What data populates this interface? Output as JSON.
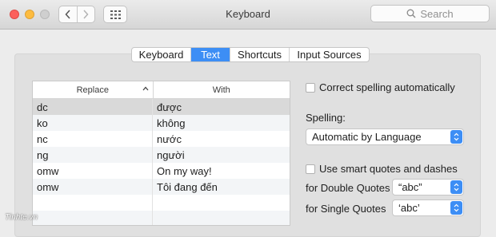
{
  "window": {
    "title": "Keyboard"
  },
  "toolbar": {
    "search_placeholder": "Search"
  },
  "tabs": [
    {
      "label": "Keyboard",
      "active": false
    },
    {
      "label": "Text",
      "active": true
    },
    {
      "label": "Shortcuts",
      "active": false
    },
    {
      "label": "Input Sources",
      "active": false
    }
  ],
  "table": {
    "columns": [
      "Replace",
      "With"
    ],
    "rows": [
      {
        "replace": "dc",
        "with": "được",
        "selected": true
      },
      {
        "replace": "ko",
        "with": "không",
        "selected": false
      },
      {
        "replace": "nc",
        "with": "nước",
        "selected": false
      },
      {
        "replace": "ng",
        "with": "người",
        "selected": false
      },
      {
        "replace": "omw",
        "with": "On my way!",
        "selected": false
      },
      {
        "replace": "omw",
        "with": "Tôi đang đến",
        "selected": false
      },
      {
        "replace": "",
        "with": "",
        "selected": false
      },
      {
        "replace": "",
        "with": "",
        "selected": false
      }
    ]
  },
  "settings": {
    "correct_spelling_label": "Correct spelling automatically",
    "spelling_label": "Spelling:",
    "spelling_value": "Automatic by Language",
    "smart_quotes_label": "Use smart quotes and dashes",
    "double_quotes_label": "for Double Quotes",
    "double_quotes_value": "“abc”",
    "single_quotes_label": "for Single Quotes",
    "single_quotes_value": "‘abc’"
  },
  "watermark": "Tinhte.vn",
  "colors": {
    "accent": "#3d8ef5",
    "close": "#fc605c",
    "minimize": "#fdbc40",
    "zoom_disabled": "#cfcfcf"
  }
}
